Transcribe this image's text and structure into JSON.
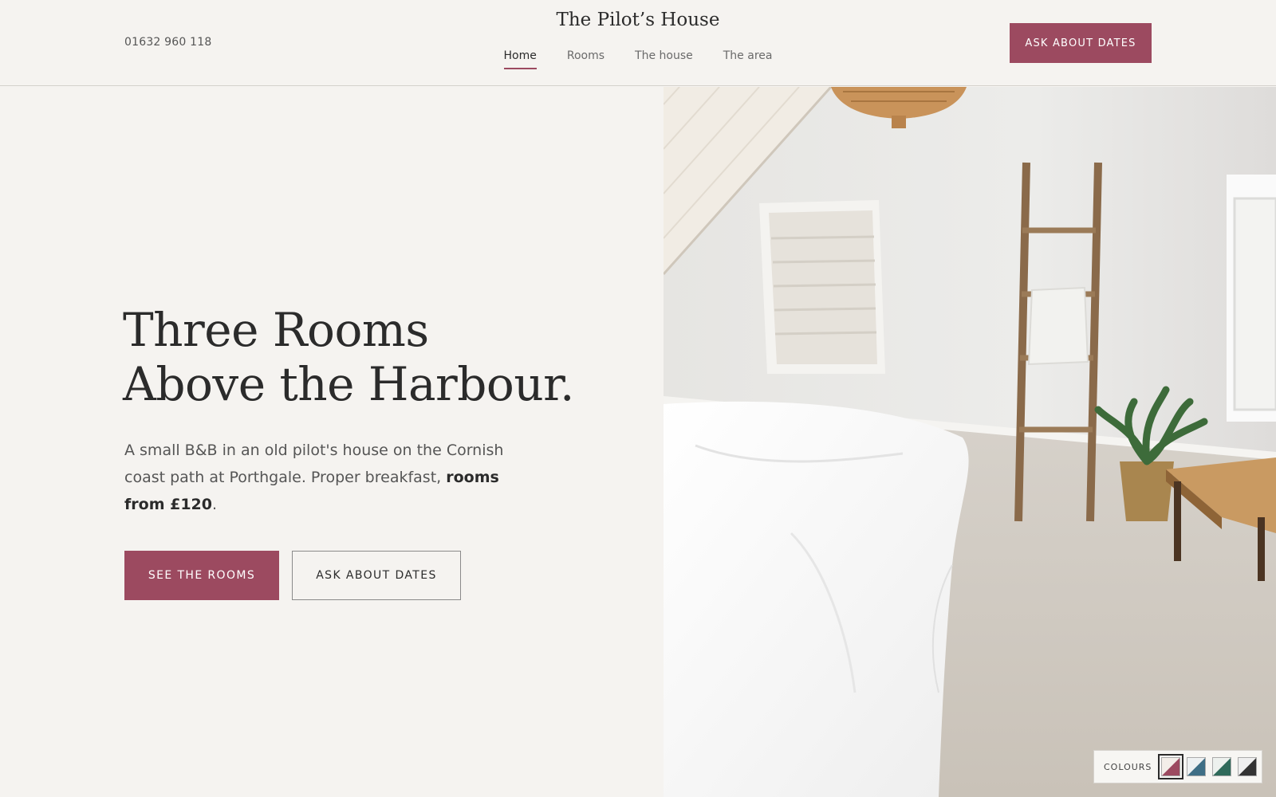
{
  "header": {
    "phone": "01632 960 118",
    "brand": "The Pilot’s House",
    "nav": [
      {
        "label": "Home",
        "active": true
      },
      {
        "label": "Rooms",
        "active": false
      },
      {
        "label": "The house",
        "active": false
      },
      {
        "label": "The area",
        "active": false
      }
    ],
    "cta_label": "ASK ABOUT DATES"
  },
  "hero": {
    "title_line1": "Three Rooms",
    "title_line2": "Above the Harbour.",
    "desc_text": "A small B&B in an old pilot's house on the Cornish coast path at Porthgale. Proper breakfast, ",
    "desc_bold": "rooms from £120",
    "desc_end": ".",
    "primary_label": "SEE THE ROOMS",
    "secondary_label": "ASK ABOUT DATES"
  },
  "colour_switcher": {
    "label": "COLOURS",
    "swatches": [
      {
        "name": "rose",
        "color": "#9c4a60",
        "selected": true
      },
      {
        "name": "blue",
        "color": "#3f6f86",
        "selected": false
      },
      {
        "name": "green",
        "color": "#2f6a5a",
        "selected": false
      },
      {
        "name": "charcoal",
        "color": "#333333",
        "selected": false
      }
    ]
  },
  "colors": {
    "accent": "#9c4a60",
    "background": "#f5f3f0"
  }
}
